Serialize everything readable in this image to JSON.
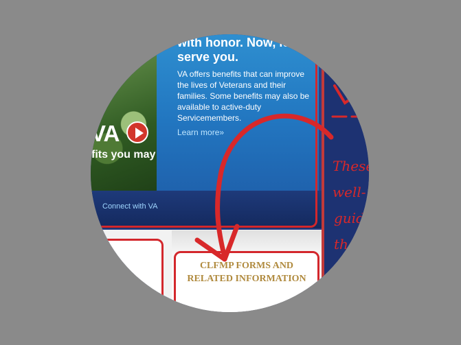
{
  "hero": {
    "logo_text": "VA",
    "tagline": "fits you may"
  },
  "promo": {
    "headline": "with honor. Now, let serve you.",
    "body": "VA offers benefits that can improve the lives of Veterans and their families. Some benefits may also be available to active-duty Servicemembers.",
    "learn_more": "Learn more",
    "learn_more_arrow": "»"
  },
  "band": {
    "connect": "Connect with VA"
  },
  "forms": {
    "title_line1": "CLFMP FORMS AND",
    "title_line2": "RELATED INFORMATION"
  },
  "annotation": {
    "lines": [
      "These",
      "well-",
      "guid",
      "th"
    ]
  },
  "colors": {
    "accent_red": "#d3272c",
    "navy": "#1d3272",
    "promo_blue": "#2276c0",
    "forms_gold": "#b08a3e"
  }
}
